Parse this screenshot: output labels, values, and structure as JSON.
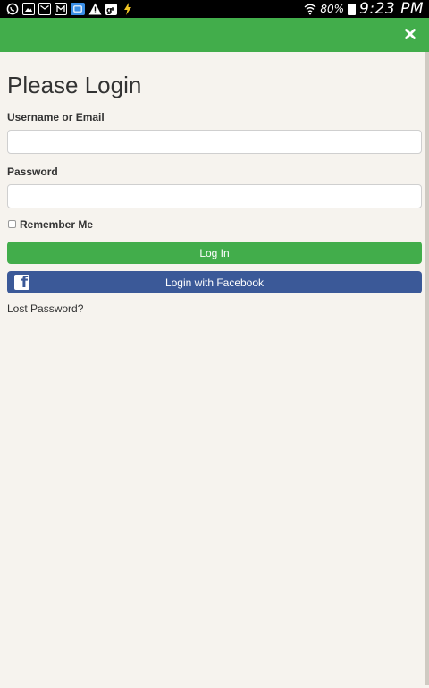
{
  "statusbar": {
    "battery_percent": "80%",
    "time": "9:23 PM",
    "icons": [
      "whatsapp-icon",
      "image-icon",
      "email-icon",
      "gmail-icon",
      "screen-icon",
      "warning-icon",
      "google-plus-icon",
      "bolt-icon",
      "wifi-icon",
      "battery-icon"
    ]
  },
  "topbar": {
    "close_icon": "close-icon",
    "color": "#42ad4b"
  },
  "login": {
    "title": "Please Login",
    "username_label": "Username or Email",
    "username_value": "",
    "password_label": "Password",
    "password_value": "",
    "remember_label": "Remember Me",
    "remember_checked": false,
    "login_button": "Log In",
    "facebook_button": "Login with Facebook",
    "lost_password": "Lost Password?"
  },
  "colors": {
    "accent_green": "#42ad4b",
    "facebook_blue": "#3b5998",
    "background": "#f6f3ee"
  }
}
